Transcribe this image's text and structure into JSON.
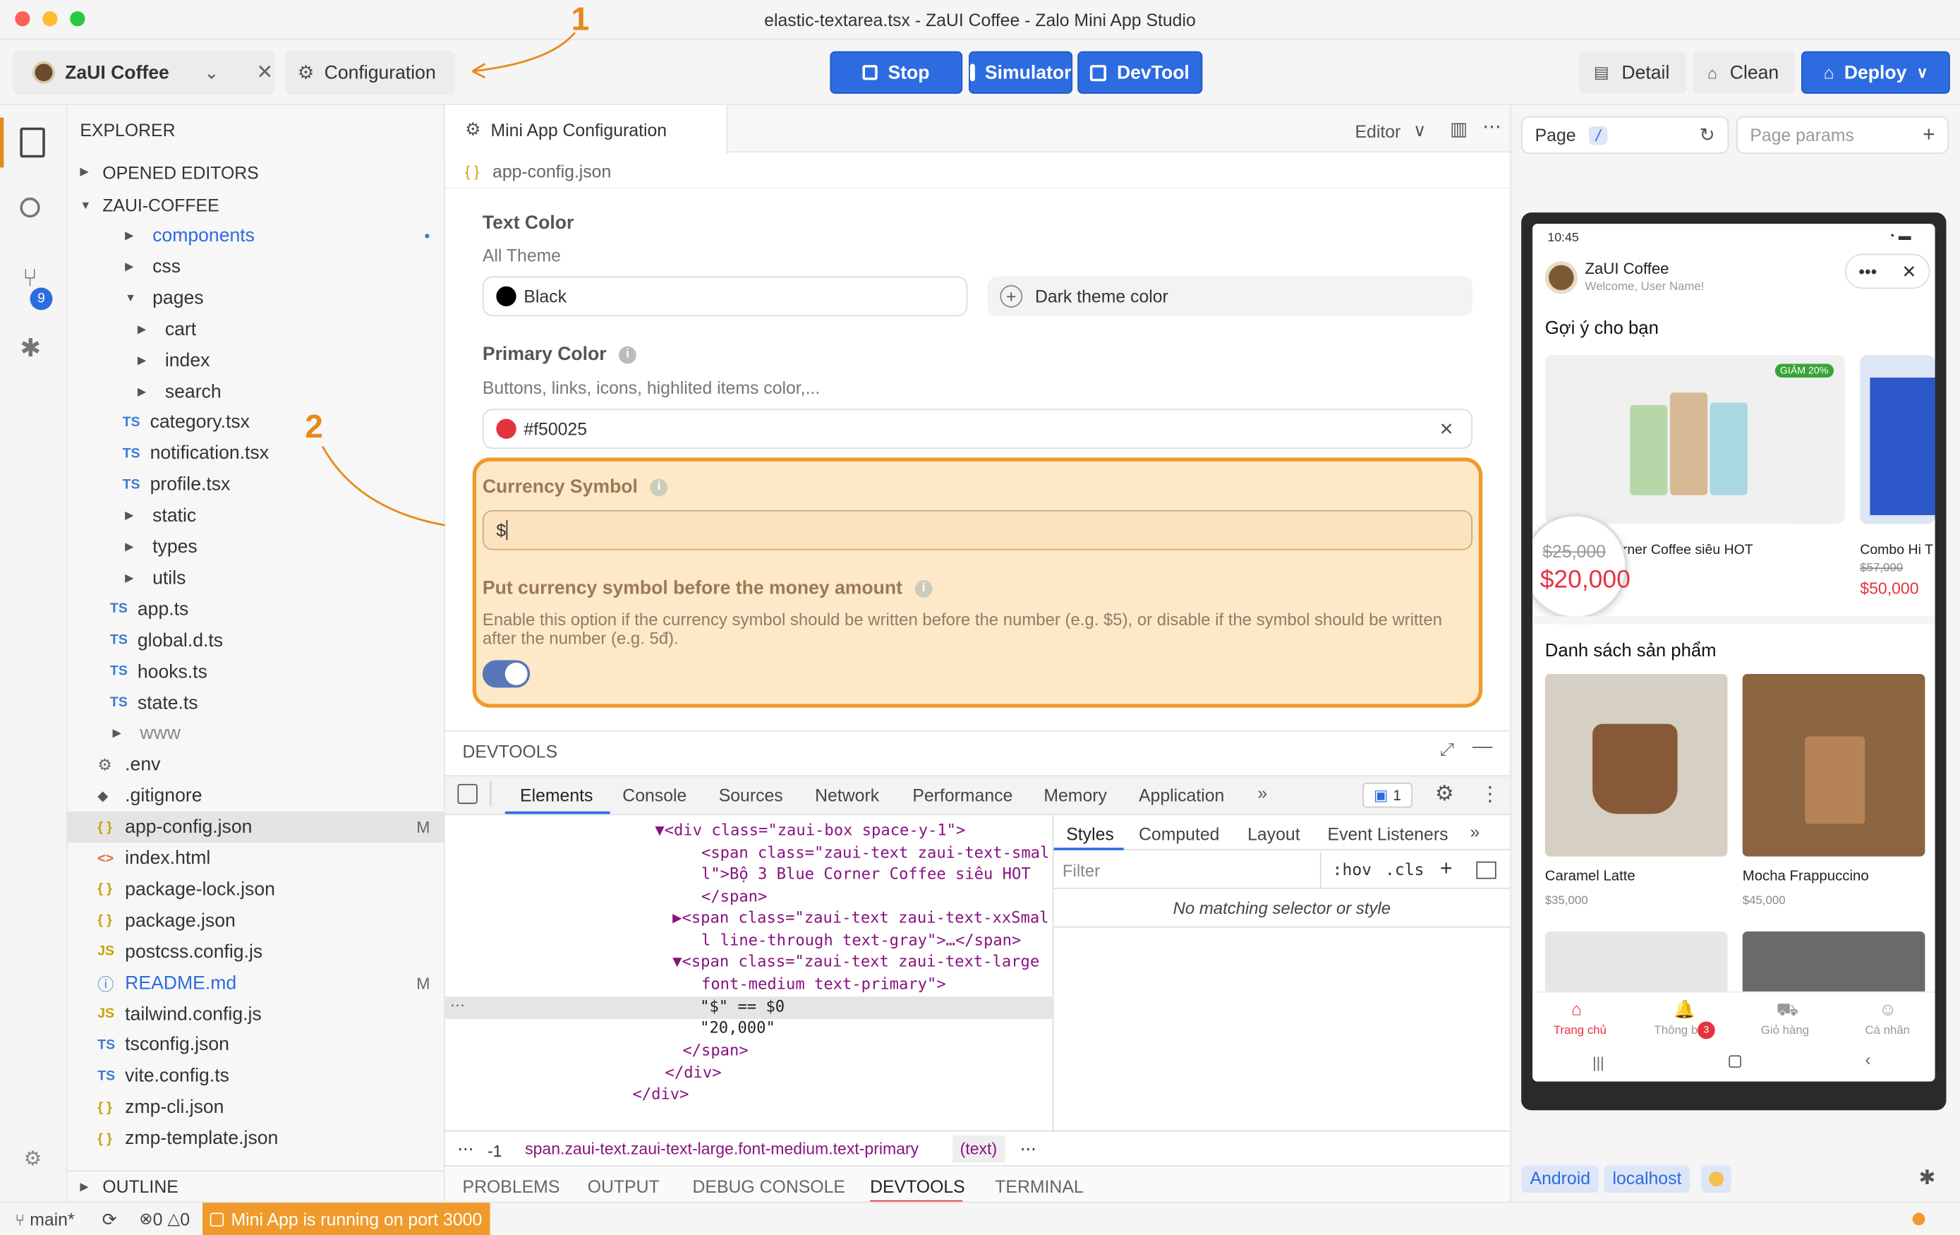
{
  "window": {
    "title": "elastic-textarea.tsx - ZaUI Coffee - Zalo Mini App Studio"
  },
  "annotations": {
    "a1": "1",
    "a2": "2"
  },
  "toolbar": {
    "project": "ZaUI Coffee",
    "config": "Configuration",
    "stop": "Stop",
    "simulator": "Simulator",
    "devtool": "DevTool",
    "detail": "Detail",
    "clean": "Clean",
    "deploy": "Deploy"
  },
  "activity": {
    "badge": "9"
  },
  "explorer": {
    "title": "EXPLORER",
    "opened_editors": "OPENED EDITORS",
    "root": "ZAUI-COFFEE",
    "outline": "OUTLINE",
    "items": [
      {
        "label": "components",
        "mark": "•"
      },
      {
        "label": "css"
      },
      {
        "label": "pages"
      },
      {
        "label": "cart"
      },
      {
        "label": "index"
      },
      {
        "label": "search"
      },
      {
        "label": "category.tsx",
        "icon": "TS"
      },
      {
        "label": "notification.tsx",
        "icon": "TS"
      },
      {
        "label": "profile.tsx",
        "icon": "TS"
      },
      {
        "label": "static"
      },
      {
        "label": "types"
      },
      {
        "label": "utils"
      },
      {
        "label": "app.ts",
        "icon": "TS"
      },
      {
        "label": "global.d.ts",
        "icon": "TS"
      },
      {
        "label": "hooks.ts",
        "icon": "TS"
      },
      {
        "label": "state.ts",
        "icon": "TS"
      },
      {
        "label": "www"
      },
      {
        "label": ".env"
      },
      {
        "label": ".gitignore"
      },
      {
        "label": "app-config.json",
        "icon": "{ }",
        "mark": "M"
      },
      {
        "label": "index.html",
        "icon": "<>"
      },
      {
        "label": "package-lock.json",
        "icon": "{ }"
      },
      {
        "label": "package.json",
        "icon": "{ }"
      },
      {
        "label": "postcss.config.js",
        "icon": "JS"
      },
      {
        "label": "README.md",
        "mark": "M"
      },
      {
        "label": "tailwind.config.js",
        "icon": "JS"
      },
      {
        "label": "tsconfig.json",
        "icon": "TS"
      },
      {
        "label": "vite.config.ts",
        "icon": "TS"
      },
      {
        "label": "zmp-cli.json",
        "icon": "{ }"
      },
      {
        "label": "zmp-template.json",
        "icon": "{ }"
      }
    ]
  },
  "editor": {
    "tab": "Mini App Configuration",
    "mode": "Editor",
    "breadcrumb": "app-config.json",
    "text_color": {
      "label": "Text Color",
      "sub": "All Theme",
      "value": "Black",
      "dark": "Dark theme color"
    },
    "primary_color": {
      "label": "Primary Color",
      "sub": "Buttons, links, icons, highlited items color,...",
      "value": "#f50025",
      "swatch": "#e5323f"
    },
    "currency": {
      "label": "Currency Symbol",
      "value": "$"
    },
    "before": {
      "label": "Put currency symbol before the money amount",
      "desc": "Enable this option if the currency symbol should be written before the number (e.g. $5), or disable if the symbol should be written after the number (e.g. 5đ)."
    },
    "highlight": "#ef9a2a"
  },
  "devtools": {
    "title": "DEVTOOLS",
    "tabs": [
      "Elements",
      "Console",
      "Sources",
      "Network",
      "Performance",
      "Memory",
      "Application"
    ],
    "issues": "1",
    "style_tabs": [
      "Styles",
      "Computed",
      "Layout",
      "Event Listeners"
    ],
    "filter_placeholder": "Filter",
    "hov": ":hov",
    "cls": ".cls",
    "no_match": "No matching selector or style",
    "code": [
      "▼<div class=\"zaui-box space-y-1\">",
      "  <span class=\"zaui-text zaui-text-smal",
      "  l\">Bộ 3 Blue Corner Coffee siêu HOT",
      "  </span>",
      "▶<span class=\"zaui-text zaui-text-xxSmal",
      "  l line-through text-gray\">…</span>",
      "▼<span class=\"zaui-text zaui-text-large",
      "  font-medium text-primary\">",
      "\"$\" == $0",
      "\"20,000\"",
      "</span>",
      "</div>",
      "</div>"
    ],
    "crumb_num": "-1",
    "crumb": "span.zaui-text.zaui-text-large.font-medium.text-primary",
    "crumb_text": "(text)"
  },
  "bottom_tabs": [
    "PROBLEMS",
    "OUTPUT",
    "DEBUG CONSOLE",
    "DEVTOOLS",
    "TERMINAL"
  ],
  "preview": {
    "page": "Page",
    "path": "/",
    "params": "Page params",
    "time": "10:45",
    "app_name": "ZaUI Coffee",
    "welcome": "Welcome, User Name!",
    "section1": "Gợi ý cho bạn",
    "discount": "GIẢM 20%",
    "promo1_title": "Bộ 3 Blue Corner Coffee siêu HOT",
    "promo1_name_visible": "orner Coffee siêu HOT",
    "promo1_old": "$25,000",
    "promo1_new": "$20,000",
    "promo2_title": "Combo Hi T",
    "promo2_old": "$57,000",
    "promo2_new": "$50,000",
    "section2": "Danh sách sản phẩm",
    "products": [
      {
        "name": "Caramel Latte",
        "price": "$35,000"
      },
      {
        "name": "Mocha Frappuccino",
        "price": "$45,000"
      }
    ],
    "nav": [
      "Trang chủ",
      "Thông báo",
      "Giỏ hàng",
      "Cá nhân"
    ],
    "cart_badge": "3",
    "tags": [
      "Android",
      "localhost"
    ]
  },
  "status": {
    "branch": "main*",
    "errors": "0",
    "warnings": "0",
    "running": "Mini App is running on port 3000"
  }
}
